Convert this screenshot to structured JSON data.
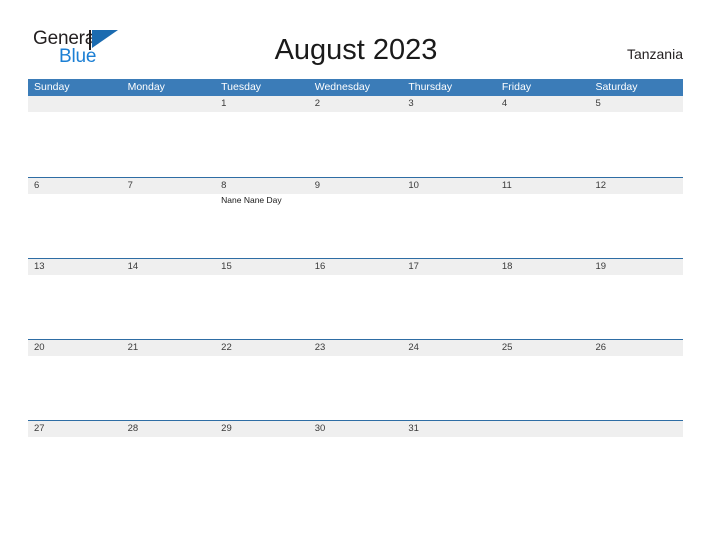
{
  "branding": {
    "logo_primary": "General",
    "logo_secondary": "Blue",
    "accent_color": "#1b7fd4",
    "flag_icon": "flag-triangle-icon"
  },
  "header": {
    "title": "August 2023",
    "region": "Tanzania"
  },
  "calendar": {
    "header_bg": "#3b7cb8",
    "row_band_bg": "#efefef",
    "row_border_color": "#2e6da4",
    "weekdays": [
      "Sunday",
      "Monday",
      "Tuesday",
      "Wednesday",
      "Thursday",
      "Friday",
      "Saturday"
    ],
    "weeks": [
      [
        {
          "num": "",
          "events": []
        },
        {
          "num": "",
          "events": []
        },
        {
          "num": "1",
          "events": []
        },
        {
          "num": "2",
          "events": []
        },
        {
          "num": "3",
          "events": []
        },
        {
          "num": "4",
          "events": []
        },
        {
          "num": "5",
          "events": []
        }
      ],
      [
        {
          "num": "6",
          "events": []
        },
        {
          "num": "7",
          "events": []
        },
        {
          "num": "8",
          "events": [
            "Nane Nane Day"
          ]
        },
        {
          "num": "9",
          "events": []
        },
        {
          "num": "10",
          "events": []
        },
        {
          "num": "11",
          "events": []
        },
        {
          "num": "12",
          "events": []
        }
      ],
      [
        {
          "num": "13",
          "events": []
        },
        {
          "num": "14",
          "events": []
        },
        {
          "num": "15",
          "events": []
        },
        {
          "num": "16",
          "events": []
        },
        {
          "num": "17",
          "events": []
        },
        {
          "num": "18",
          "events": []
        },
        {
          "num": "19",
          "events": []
        }
      ],
      [
        {
          "num": "20",
          "events": []
        },
        {
          "num": "21",
          "events": []
        },
        {
          "num": "22",
          "events": []
        },
        {
          "num": "23",
          "events": []
        },
        {
          "num": "24",
          "events": []
        },
        {
          "num": "25",
          "events": []
        },
        {
          "num": "26",
          "events": []
        }
      ],
      [
        {
          "num": "27",
          "events": []
        },
        {
          "num": "28",
          "events": []
        },
        {
          "num": "29",
          "events": []
        },
        {
          "num": "30",
          "events": []
        },
        {
          "num": "31",
          "events": []
        },
        {
          "num": "",
          "events": []
        },
        {
          "num": "",
          "events": []
        }
      ]
    ]
  }
}
